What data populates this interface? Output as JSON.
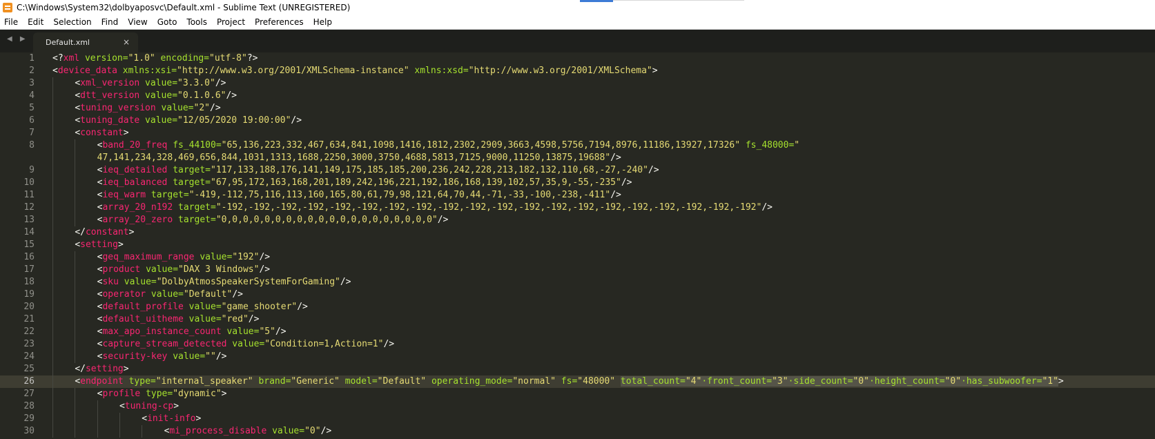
{
  "window": {
    "title": "C:\\Windows\\System32\\dolbyaposvc\\Default.xml - Sublime Text (UNREGISTERED)"
  },
  "menu": [
    "File",
    "Edit",
    "Selection",
    "Find",
    "View",
    "Goto",
    "Tools",
    "Project",
    "Preferences",
    "Help"
  ],
  "tabs": [
    {
      "label": "Default.xml",
      "close": "×",
      "active": true
    }
  ],
  "nav": {
    "arrows": "◀ ▶"
  },
  "editor": {
    "current_line": 26,
    "selection_text": "total_count=\"4\"·front_count=\"3\"·side_count=\"0\"·height_count=\"0\"·has_subwoofer=\"1\"",
    "lines": [
      {
        "n": 1,
        "indent": 0,
        "tokens": [
          [
            "p",
            "<?"
          ],
          [
            "t",
            "xml"
          ],
          [
            "a",
            " version="
          ],
          [
            "s",
            "\"1.0\""
          ],
          [
            "a",
            " encoding="
          ],
          [
            "s",
            "\"utf-8\""
          ],
          [
            "p",
            "?>"
          ]
        ]
      },
      {
        "n": 2,
        "indent": 0,
        "tokens": [
          [
            "p",
            "<"
          ],
          [
            "t",
            "device_data"
          ],
          [
            "a",
            " xmlns:xsi="
          ],
          [
            "s",
            "\"http://www.w3.org/2001/XMLSchema-instance\""
          ],
          [
            "a",
            " xmlns:xsd="
          ],
          [
            "s",
            "\"http://www.w3.org/2001/XMLSchema\""
          ],
          [
            "p",
            ">"
          ]
        ]
      },
      {
        "n": 3,
        "indent": 1,
        "tokens": [
          [
            "p",
            "<"
          ],
          [
            "t",
            "xml_version"
          ],
          [
            "a",
            " value="
          ],
          [
            "s",
            "\"3.3.0\""
          ],
          [
            "p",
            "/>"
          ]
        ]
      },
      {
        "n": 4,
        "indent": 1,
        "tokens": [
          [
            "p",
            "<"
          ],
          [
            "t",
            "dtt_version"
          ],
          [
            "a",
            " value="
          ],
          [
            "s",
            "\"0.1.0.6\""
          ],
          [
            "p",
            "/>"
          ]
        ]
      },
      {
        "n": 5,
        "indent": 1,
        "tokens": [
          [
            "p",
            "<"
          ],
          [
            "t",
            "tuning_version"
          ],
          [
            "a",
            " value="
          ],
          [
            "s",
            "\"2\""
          ],
          [
            "p",
            "/>"
          ]
        ]
      },
      {
        "n": 6,
        "indent": 1,
        "tokens": [
          [
            "p",
            "<"
          ],
          [
            "t",
            "tuning_date"
          ],
          [
            "a",
            " value="
          ],
          [
            "s",
            "\"12/05/2020 19:00:00\""
          ],
          [
            "p",
            "/>"
          ]
        ]
      },
      {
        "n": 7,
        "indent": 1,
        "tokens": [
          [
            "p",
            "<"
          ],
          [
            "t",
            "constant"
          ],
          [
            "p",
            ">"
          ]
        ]
      },
      {
        "n": 8,
        "indent": 2,
        "tokens": [
          [
            "p",
            "<"
          ],
          [
            "t",
            "band_20_freq"
          ],
          [
            "a",
            " fs_44100="
          ],
          [
            "s",
            "\"65,136,223,332,467,634,841,1098,1416,1812,2302,2909,3663,4598,5756,7194,8976,11186,13927,17326\""
          ],
          [
            "a",
            " fs_48000="
          ],
          [
            "s",
            "\""
          ]
        ]
      },
      {
        "n": "",
        "indent": 2,
        "tokens": [
          [
            "s",
            "47,141,234,328,469,656,844,1031,1313,1688,2250,3000,3750,4688,5813,7125,9000,11250,13875,19688\""
          ],
          [
            "p",
            "/>"
          ]
        ]
      },
      {
        "n": 9,
        "indent": 2,
        "tokens": [
          [
            "p",
            "<"
          ],
          [
            "t",
            "ieq_detailed"
          ],
          [
            "a",
            " target="
          ],
          [
            "s",
            "\"117,133,188,176,141,149,175,185,185,200,236,242,228,213,182,132,110,68,-27,-240\""
          ],
          [
            "p",
            "/>"
          ]
        ]
      },
      {
        "n": 10,
        "indent": 2,
        "tokens": [
          [
            "p",
            "<"
          ],
          [
            "t",
            "ieq_balanced"
          ],
          [
            "a",
            " target="
          ],
          [
            "s",
            "\"67,95,172,163,168,201,189,242,196,221,192,186,168,139,102,57,35,9,-55,-235\""
          ],
          [
            "p",
            "/>"
          ]
        ]
      },
      {
        "n": 11,
        "indent": 2,
        "tokens": [
          [
            "p",
            "<"
          ],
          [
            "t",
            "ieq_warm"
          ],
          [
            "a",
            " target="
          ],
          [
            "s",
            "\"-419,-112,75,116,113,160,165,80,61,79,98,121,64,70,44,-71,-33,-100,-238,-411\""
          ],
          [
            "p",
            "/>"
          ]
        ]
      },
      {
        "n": 12,
        "indent": 2,
        "tokens": [
          [
            "p",
            "<"
          ],
          [
            "t",
            "array_20_n192"
          ],
          [
            "a",
            " target="
          ],
          [
            "s",
            "\"-192,-192,-192,-192,-192,-192,-192,-192,-192,-192,-192,-192,-192,-192,-192,-192,-192,-192,-192,-192\""
          ],
          [
            "p",
            "/>"
          ]
        ]
      },
      {
        "n": 13,
        "indent": 2,
        "tokens": [
          [
            "p",
            "<"
          ],
          [
            "t",
            "array_20_zero"
          ],
          [
            "a",
            " target="
          ],
          [
            "s",
            "\"0,0,0,0,0,0,0,0,0,0,0,0,0,0,0,0,0,0,0,0\""
          ],
          [
            "p",
            "/>"
          ]
        ]
      },
      {
        "n": 14,
        "indent": 1,
        "tokens": [
          [
            "p",
            "</"
          ],
          [
            "t",
            "constant"
          ],
          [
            "p",
            ">"
          ]
        ]
      },
      {
        "n": 15,
        "indent": 1,
        "tokens": [
          [
            "p",
            "<"
          ],
          [
            "t",
            "setting"
          ],
          [
            "p",
            ">"
          ]
        ]
      },
      {
        "n": 16,
        "indent": 2,
        "tokens": [
          [
            "p",
            "<"
          ],
          [
            "t",
            "geq_maximum_range"
          ],
          [
            "a",
            " value="
          ],
          [
            "s",
            "\"192\""
          ],
          [
            "p",
            "/>"
          ]
        ]
      },
      {
        "n": 17,
        "indent": 2,
        "tokens": [
          [
            "p",
            "<"
          ],
          [
            "t",
            "product"
          ],
          [
            "a",
            " value="
          ],
          [
            "s",
            "\"DAX 3 Windows\""
          ],
          [
            "p",
            "/>"
          ]
        ]
      },
      {
        "n": 18,
        "indent": 2,
        "tokens": [
          [
            "p",
            "<"
          ],
          [
            "t",
            "sku"
          ],
          [
            "a",
            " value="
          ],
          [
            "s",
            "\"DolbyAtmosSpeakerSystemForGaming\""
          ],
          [
            "p",
            "/>"
          ]
        ]
      },
      {
        "n": 19,
        "indent": 2,
        "tokens": [
          [
            "p",
            "<"
          ],
          [
            "t",
            "operator"
          ],
          [
            "a",
            " value="
          ],
          [
            "s",
            "\"Default\""
          ],
          [
            "p",
            "/>"
          ]
        ]
      },
      {
        "n": 20,
        "indent": 2,
        "tokens": [
          [
            "p",
            "<"
          ],
          [
            "t",
            "default_profile"
          ],
          [
            "a",
            " value="
          ],
          [
            "s",
            "\"game_shooter\""
          ],
          [
            "p",
            "/>"
          ]
        ]
      },
      {
        "n": 21,
        "indent": 2,
        "tokens": [
          [
            "p",
            "<"
          ],
          [
            "t",
            "default_uitheme"
          ],
          [
            "a",
            " value="
          ],
          [
            "s",
            "\"red\""
          ],
          [
            "p",
            "/>"
          ]
        ]
      },
      {
        "n": 22,
        "indent": 2,
        "tokens": [
          [
            "p",
            "<"
          ],
          [
            "t",
            "max_apo_instance_count"
          ],
          [
            "a",
            " value="
          ],
          [
            "s",
            "\"5\""
          ],
          [
            "p",
            "/>"
          ]
        ]
      },
      {
        "n": 23,
        "indent": 2,
        "tokens": [
          [
            "p",
            "<"
          ],
          [
            "t",
            "capture_stream_detected"
          ],
          [
            "a",
            " value="
          ],
          [
            "s",
            "\"Condition=1,Action=1\""
          ],
          [
            "p",
            "/>"
          ]
        ]
      },
      {
        "n": 24,
        "indent": 2,
        "tokens": [
          [
            "p",
            "<"
          ],
          [
            "t",
            "security-key"
          ],
          [
            "a",
            " value="
          ],
          [
            "s",
            "\"\""
          ],
          [
            "p",
            "/>"
          ]
        ]
      },
      {
        "n": 25,
        "indent": 1,
        "tokens": [
          [
            "p",
            "</"
          ],
          [
            "t",
            "setting"
          ],
          [
            "p",
            ">"
          ]
        ]
      },
      {
        "n": 26,
        "indent": 1,
        "tokens": [
          [
            "p",
            "<"
          ],
          [
            "t",
            "endpoint"
          ],
          [
            "a",
            " type="
          ],
          [
            "s",
            "\"internal_speaker\""
          ],
          [
            "a",
            " brand="
          ],
          [
            "s",
            "\"Generic\""
          ],
          [
            "a",
            " model="
          ],
          [
            "s",
            "\"Default\""
          ],
          [
            "a",
            " operating_mode="
          ],
          [
            "s",
            "\"normal\""
          ],
          [
            "a",
            " fs="
          ],
          [
            "s",
            "\"48000\""
          ],
          [
            "p",
            " "
          ],
          [
            "SEL",
            ""
          ],
          [
            "p",
            ">"
          ]
        ]
      },
      {
        "n": 27,
        "indent": 2,
        "tokens": [
          [
            "p",
            "<"
          ],
          [
            "t",
            "profile"
          ],
          [
            "a",
            " type="
          ],
          [
            "s",
            "\"dynamic\""
          ],
          [
            "p",
            ">"
          ]
        ]
      },
      {
        "n": 28,
        "indent": 3,
        "tokens": [
          [
            "p",
            "<"
          ],
          [
            "t",
            "tuning-cp"
          ],
          [
            "p",
            ">"
          ]
        ]
      },
      {
        "n": 29,
        "indent": 4,
        "tokens": [
          [
            "p",
            "<"
          ],
          [
            "t",
            "init-info"
          ],
          [
            "p",
            ">"
          ]
        ]
      },
      {
        "n": 30,
        "indent": 5,
        "tokens": [
          [
            "p",
            "<"
          ],
          [
            "t",
            "mi_process_disable"
          ],
          [
            "a",
            " value="
          ],
          [
            "s",
            "\"0\""
          ],
          [
            "p",
            "/>"
          ]
        ]
      }
    ]
  }
}
